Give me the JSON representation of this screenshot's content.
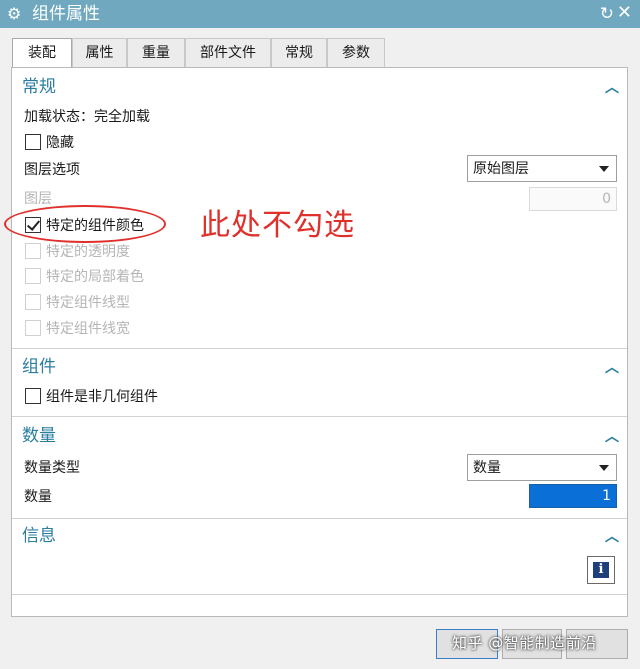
{
  "window": {
    "title": "组件属性",
    "reset_glyph": "↻",
    "close_glyph": "✕"
  },
  "tabs": [
    {
      "label": "装配",
      "active": true
    },
    {
      "label": "属性",
      "active": false
    },
    {
      "label": "重量",
      "active": false
    },
    {
      "label": "部件文件",
      "active": false
    },
    {
      "label": "常规",
      "active": false
    },
    {
      "label": "参数",
      "active": false
    }
  ],
  "sections": {
    "general": {
      "title": "常规",
      "load_status": "加载状态：完全加载",
      "hide_label": "隐藏",
      "layer_option_label": "图层选项",
      "layer_option_value": "原始图层",
      "layer_label": "图层",
      "layer_value": "0",
      "specific_color_label": "特定的组件颜色",
      "specific_transparency_label": "特定的透明度",
      "specific_partial_shading_label": "特定的局部着色",
      "specific_line_style_label": "特定组件线型",
      "specific_line_width_label": "特定组件线宽"
    },
    "component": {
      "title": "组件",
      "non_geometric_label": "组件是非几何组件"
    },
    "quantity": {
      "title": "数量",
      "type_label": "数量类型",
      "type_value": "数量",
      "quantity_label": "数量",
      "quantity_value": "1"
    },
    "info": {
      "title": "信息",
      "info_glyph": "i"
    }
  },
  "annotation": {
    "text": "此处不勾选",
    "color": "#e0302b"
  },
  "watermark": "知乎 @智能制造前沿",
  "colors": {
    "titlebar": "#6fa8bf",
    "section_title": "#2a7da0",
    "active_field": "#0a6fd6"
  },
  "checkboxes": {
    "hide": false,
    "specific_color": true,
    "non_geometric": false
  }
}
